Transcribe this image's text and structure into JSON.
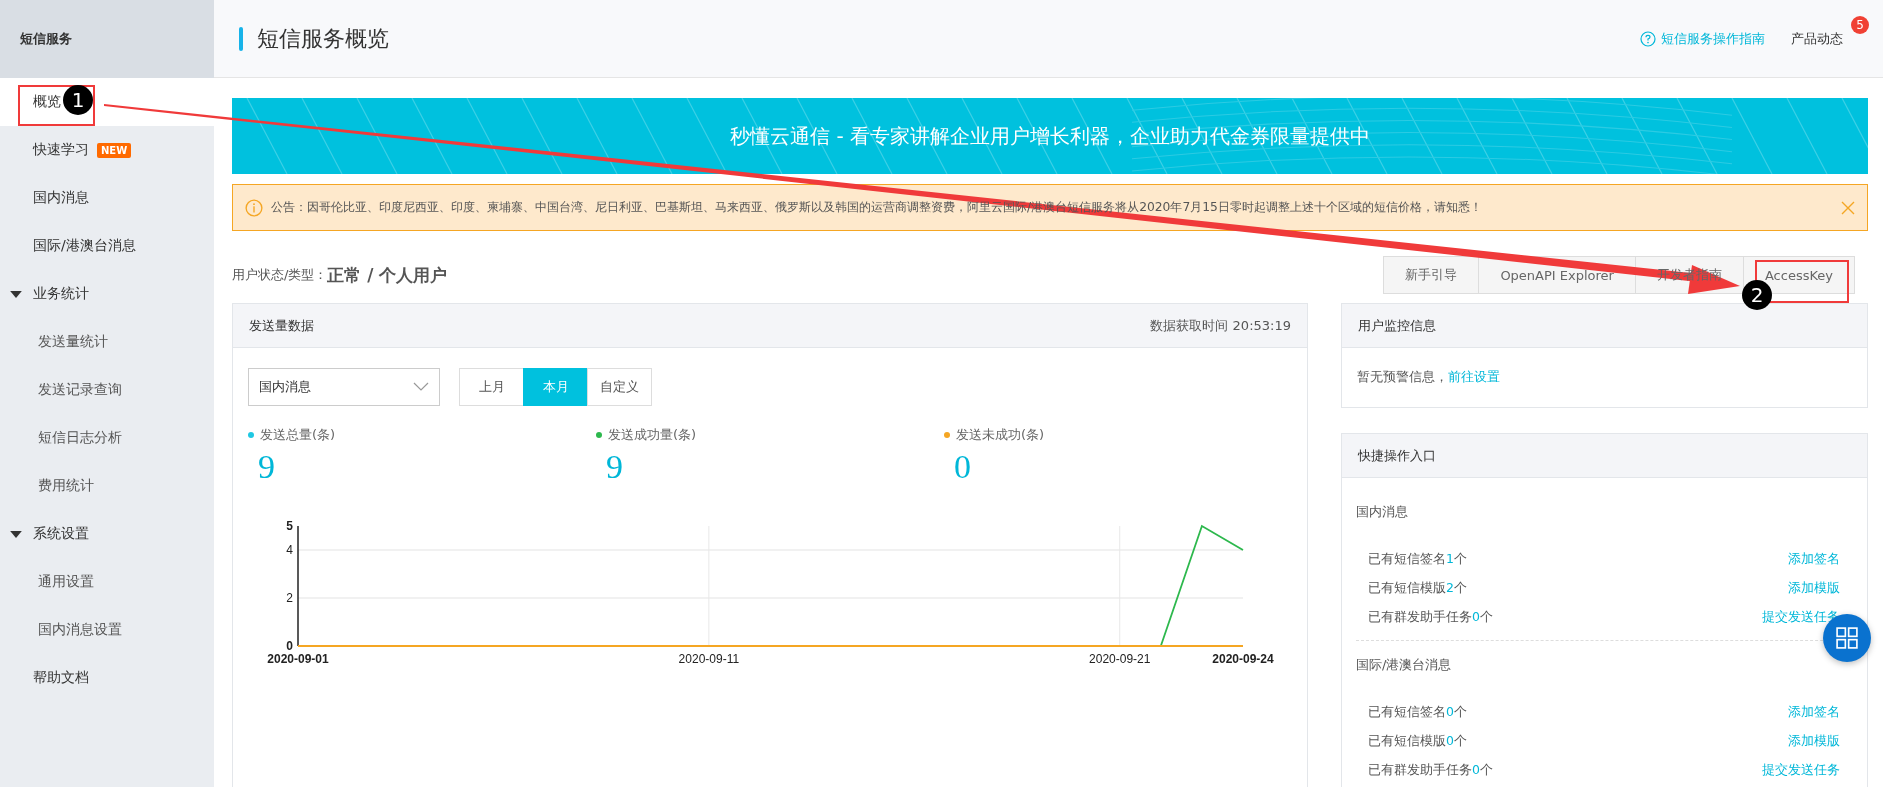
{
  "sidebar": {
    "title": "短信服务",
    "items": [
      {
        "label": "概览",
        "selected": true
      },
      {
        "label": "快速学习",
        "badge": "NEW",
        "selected": false
      },
      {
        "label": "国内消息",
        "selected": false
      },
      {
        "label": "国际/港澳台消息",
        "selected": false
      },
      {
        "label": "业务统计",
        "expanded": true,
        "selected": false,
        "children": [
          {
            "label": "发送量统计",
            "selected": false
          },
          {
            "label": "发送记录查询",
            "selected": false
          },
          {
            "label": "短信日志分析",
            "selected": false
          },
          {
            "label": "费用统计",
            "selected": false
          }
        ]
      },
      {
        "label": "系统设置",
        "expanded": true,
        "selected": false,
        "children": [
          {
            "label": "通用设置",
            "selected": false
          },
          {
            "label": "国内消息设置",
            "selected": false
          }
        ]
      },
      {
        "label": "帮助文档",
        "selected": false
      }
    ]
  },
  "header": {
    "title": "短信服务概览",
    "guide_link": "短信服务操作指南",
    "news": "产品动态",
    "news_count": "5"
  },
  "banner": {
    "text": "秒懂云通信 - 看专家讲解企业用户增长利器，企业助力代金券限量提供中"
  },
  "notice": {
    "text": "公告：因哥伦比亚、印度尼西亚、印度、柬埔寨、中国台湾、尼日利亚、巴基斯坦、马来西亚、俄罗斯以及韩国的运营商调整资费，阿里云国际/港澳台短信服务将从2020年7月15日零时起调整上述十个区域的短信价格，请知悉！"
  },
  "user_status": {
    "label": "用户状态/类型：",
    "value": "正常 / 个人用户"
  },
  "quick_buttons": [
    "新手引导",
    "OpenAPI Explorer",
    "开发者指南",
    "AccessKey"
  ],
  "send_panel": {
    "title": "发送量数据",
    "fetch_time": "数据获取时间 20:53:19",
    "dropdown": "国内消息",
    "ranges": [
      {
        "label": "上月",
        "selected": false
      },
      {
        "label": "本月",
        "selected": true
      },
      {
        "label": "自定义",
        "selected": false
      }
    ],
    "stats": [
      {
        "label": "发送总量(条)",
        "value": "9",
        "color": "#1fc8e3"
      },
      {
        "label": "发送成功量(条)",
        "value": "9",
        "color": "#2db84d"
      },
      {
        "label": "发送未成功(条)",
        "value": "0",
        "color": "#f5a623"
      }
    ],
    "chart_data": {
      "type": "line",
      "categories": [
        "2020-09-01",
        null,
        null,
        null,
        null,
        null,
        null,
        null,
        null,
        null,
        "2020-09-11",
        null,
        null,
        null,
        null,
        null,
        null,
        null,
        null,
        null,
        "2020-09-21",
        null,
        null,
        "2020-09-24"
      ],
      "series": [
        {
          "color": "#2db84d",
          "values": [
            null,
            null,
            null,
            null,
            null,
            null,
            null,
            null,
            null,
            null,
            null,
            null,
            null,
            null,
            null,
            null,
            null,
            null,
            null,
            null,
            null,
            0,
            5,
            4
          ]
        },
        {
          "color": "#f5a623",
          "values": [
            0,
            0,
            0,
            0,
            0,
            0,
            0,
            0,
            0,
            0,
            0,
            0,
            0,
            0,
            0,
            0,
            0,
            0,
            0,
            0,
            0,
            0,
            0,
            0
          ]
        }
      ],
      "ylim": [
        0,
        5
      ],
      "yticks": [
        0,
        2,
        4,
        5
      ],
      "grid": true
    }
  },
  "monitor_panel": {
    "title": "用户监控信息",
    "text": "暂无预警信息，",
    "link": "前往设置"
  },
  "shortcut_panel": {
    "title": "快捷操作入口",
    "sections": [
      {
        "title": "国内消息",
        "rows": [
          {
            "prefix": "已有短信签名",
            "count": "1",
            "suffix": "个",
            "action": "添加签名"
          },
          {
            "prefix": "已有短信模版",
            "count": "2",
            "suffix": "个",
            "action": "添加模版"
          },
          {
            "prefix": "已有群发助手任务",
            "count": "0",
            "suffix": "个",
            "action": "提交发送任务"
          }
        ]
      },
      {
        "title": "国际/港澳台消息",
        "rows": [
          {
            "prefix": "已有短信签名",
            "count": "0",
            "suffix": "个",
            "action": "添加签名"
          },
          {
            "prefix": "已有短信模版",
            "count": "0",
            "suffix": "个",
            "action": "添加模版"
          },
          {
            "prefix": "已有群发助手任务",
            "count": "0",
            "suffix": "个",
            "action": "提交发送任务"
          }
        ]
      }
    ]
  },
  "annotations": [
    {
      "number": "1"
    },
    {
      "number": "2"
    }
  ]
}
